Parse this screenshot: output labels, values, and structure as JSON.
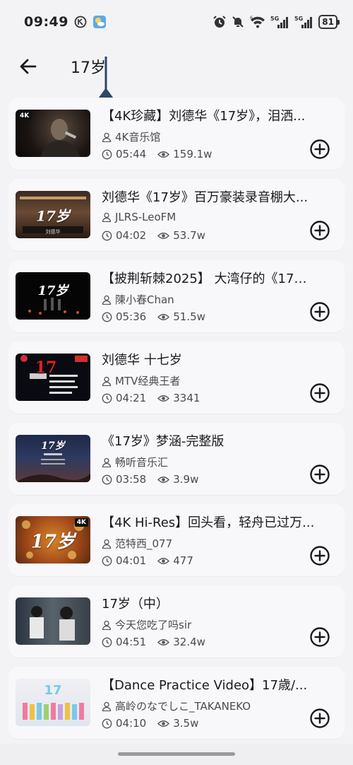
{
  "status_bar": {
    "time": "09:49",
    "battery": "81",
    "signal_1": "5G",
    "signal_2": "5G"
  },
  "search": {
    "query": "17岁"
  },
  "colors": {
    "accent": "#2b4a68",
    "background": "#f3f3f6",
    "card": "#f8f8fb"
  },
  "results": [
    {
      "title": "【4K珍藏】刘德华《17岁》，泪洒...",
      "author": "4K音乐馆",
      "duration": "05:44",
      "views": "159.1w",
      "badge": "4K",
      "thumb_text": ""
    },
    {
      "title": "刘德华《17岁》百万豪装录音棚大...",
      "author": "JLRS-LeoFM",
      "duration": "04:02",
      "views": "53.7w",
      "badge": "",
      "thumb_text": "17岁"
    },
    {
      "title": "【披荆斩棘2025】 大湾仔的《17岁...",
      "author": "陳小春Chan",
      "duration": "05:36",
      "views": "51.5w",
      "badge": "",
      "thumb_text": "17岁"
    },
    {
      "title": "刘德华 十七岁",
      "author": "MTV经典王者",
      "duration": "04:21",
      "views": "3341",
      "badge": "",
      "thumb_text": "17"
    },
    {
      "title": "《17岁》梦涵-完整版",
      "author": "畅听音乐汇",
      "duration": "03:58",
      "views": "3.9w",
      "badge": "",
      "thumb_text": "17岁"
    },
    {
      "title": "【4K Hi-Res】回头看，轻舟已过万...",
      "author": "范特西_077",
      "duration": "04:01",
      "views": "477",
      "badge": "4K",
      "thumb_text": "17岁"
    },
    {
      "title": "17岁（中）",
      "author": "今天您吃了吗sir",
      "duration": "04:51",
      "views": "32.4w",
      "badge": "",
      "thumb_text": ""
    },
    {
      "title": "【Dance Practice Video】17歳/...",
      "author": "高岭のなでしこ_TAKANEKO",
      "duration": "04:10",
      "views": "3.5w",
      "badge": "",
      "thumb_text": ""
    }
  ]
}
